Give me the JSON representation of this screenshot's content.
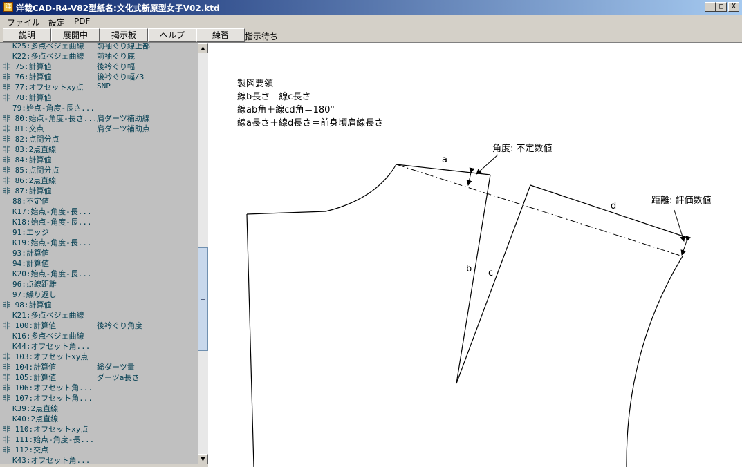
{
  "window": {
    "title": "洋裁CAD-R4-V82型紙名:文化式新原型女子V02.ktd",
    "minimize": "_",
    "maximize": "□",
    "close": "X"
  },
  "menu": [
    "ファイル",
    "設定",
    "PDF"
  ],
  "toolbar": {
    "buttons": [
      "説明",
      "展開中",
      "掲示板",
      "ヘルプ",
      "練習"
    ],
    "status": "指示待ち"
  },
  "tree": [
    {
      "label": "K25:多点ベジェ曲線",
      "comment": "前袖ぐり線上部",
      "indent": 1
    },
    {
      "label": "K22:多点ベジェ曲線",
      "comment": "前袖ぐり底",
      "indent": 1
    },
    {
      "label": "非 75:計算値",
      "comment": "後衿ぐり幅",
      "indent": 0
    },
    {
      "label": "非 76:計算値",
      "comment": "後衿ぐり幅/3",
      "indent": 0
    },
    {
      "label": "非 77:オフセットxy点",
      "comment": "SNP",
      "indent": 0
    },
    {
      "label": "非 78:計算値",
      "comment": "",
      "indent": 0
    },
    {
      "label": "79:始点-角度-長さ...",
      "comment": "",
      "indent": 2
    },
    {
      "label": "非 80:始点-角度-長さ...",
      "comment": "肩ダーツ補助線",
      "indent": 0
    },
    {
      "label": "非 81:交点",
      "comment": "肩ダーツ補助点",
      "indent": 0
    },
    {
      "label": "非 82:点間分点",
      "comment": "",
      "indent": 0
    },
    {
      "label": "非 83:2点直線",
      "comment": "",
      "indent": 0
    },
    {
      "label": "非 84:計算値",
      "comment": "",
      "indent": 0
    },
    {
      "label": "非 85:点間分点",
      "comment": "",
      "indent": 0
    },
    {
      "label": "非 86:2点直線",
      "comment": "",
      "indent": 0
    },
    {
      "label": "非 87:計算値",
      "comment": "",
      "indent": 0
    },
    {
      "label": "88:不定値",
      "comment": "",
      "indent": 2
    },
    {
      "label": "K17:始点-角度-長...",
      "comment": "",
      "indent": 1
    },
    {
      "label": "K18:始点-角度-長...",
      "comment": "",
      "indent": 1
    },
    {
      "label": "91:エッジ",
      "comment": "",
      "indent": 2
    },
    {
      "label": "K19:始点-角度-長...",
      "comment": "",
      "indent": 1
    },
    {
      "label": "93:計算値",
      "comment": "",
      "indent": 2
    },
    {
      "label": "94:計算値",
      "comment": "",
      "indent": 2
    },
    {
      "label": "K20:始点-角度-長...",
      "comment": "",
      "indent": 1
    },
    {
      "label": "96:点線距離",
      "comment": "",
      "indent": 2
    },
    {
      "label": "97:繰り返し",
      "comment": "",
      "indent": 2
    },
    {
      "label": "非 98:計算値",
      "comment": "",
      "indent": 0
    },
    {
      "label": "K21:多点ベジェ曲線",
      "comment": "",
      "indent": 1
    },
    {
      "label": "非 100:計算値",
      "comment": "後衿ぐり角度",
      "indent": 0
    },
    {
      "label": "K16:多点ベジェ曲線",
      "comment": "",
      "indent": 1
    },
    {
      "label": "K44:オフセット角...",
      "comment": "",
      "indent": 1
    },
    {
      "label": "非 103:オフセットxy点",
      "comment": "",
      "indent": 0
    },
    {
      "label": "非 104:計算値",
      "comment": "総ダーツ量",
      "indent": 0
    },
    {
      "label": "非 105:計算値",
      "comment": "ダーツa長さ",
      "indent": 0
    },
    {
      "label": "非 106:オフセット角...",
      "comment": "",
      "indent": 0
    },
    {
      "label": "非 107:オフセット角...",
      "comment": "",
      "indent": 0
    },
    {
      "label": "K39:2点直線",
      "comment": "",
      "indent": 1
    },
    {
      "label": "K40:2点直線",
      "comment": "",
      "indent": 1
    },
    {
      "label": "非 110:オフセットxy点",
      "comment": "",
      "indent": 0
    },
    {
      "label": "非 111:始点-角度-長...",
      "comment": "",
      "indent": 0
    },
    {
      "label": "非 112:交点",
      "comment": "",
      "indent": 0
    },
    {
      "label": "K43:オフセット角...",
      "comment": "",
      "indent": 1
    }
  ],
  "drawing": {
    "notes": [
      "製図要領",
      "線b長さ＝線c長さ",
      "線ab角＋線cd角＝180°",
      "線a長さ＋線d長さ＝前身頃肩線長さ"
    ],
    "labels": {
      "a": "a",
      "b": "b",
      "c": "c",
      "d": "d",
      "angle": "角度: 不定数値",
      "distance": "距離: 評価数値"
    }
  },
  "colors": {
    "title_bar_start": "#0a246a",
    "title_bar_end": "#a6caf0",
    "tree_text": "#003c50",
    "tree_bg": "#c0c0c0",
    "canvas_bg": "#ffffff"
  }
}
